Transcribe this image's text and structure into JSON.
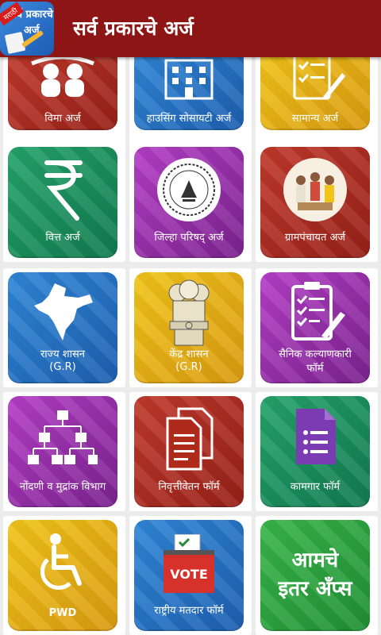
{
  "appbar": {
    "title": "सर्व प्रकारचे अर्ज",
    "icon_text_line1": "सर्व प्रकारचे",
    "icon_text_line2": "अर्ज",
    "icon_ribbon": "मराठी"
  },
  "tiles": [
    {
      "label": "विमा अर्ज",
      "icon": "people-icon"
    },
    {
      "label": "हाउसिंग सोसायटी अर्ज",
      "icon": "building-icon"
    },
    {
      "label": "सामान्य अर्ज",
      "icon": "checklist-icon"
    },
    {
      "label": "वित्त अर्ज",
      "icon": "rupee-icon"
    },
    {
      "label": "जिल्हा परिषद् अर्ज",
      "icon": "seal-icon"
    },
    {
      "label": "ग्रामपंचायत अर्ज",
      "icon": "village-meeting-icon"
    },
    {
      "label_line1": "राज्य शासन",
      "label_line2": "(G.R)",
      "icon": "india-map-icon"
    },
    {
      "label_line1": "केंद्र शासन",
      "label_line2": "(G.R)",
      "icon": "emblem-icon"
    },
    {
      "label_line1": "सैनिक कल्याणकारी",
      "label_line2": "फॉर्म",
      "icon": "clipboard-icon"
    },
    {
      "label": "नोंदणी व मुद्रांक विभाग",
      "icon": "org-chart-icon"
    },
    {
      "label": "निवृत्तीवेतन फॉर्म",
      "icon": "documents-icon"
    },
    {
      "label": "कामगार फॉर्म",
      "icon": "form-icon"
    },
    {
      "label": "PWD",
      "icon": "wheelchair-icon"
    },
    {
      "label": "राष्ट्रीय मतदार फॉर्म",
      "icon": "vote-icon",
      "icon_text": "VOTE"
    },
    {
      "line1": "आमचे",
      "line2": "इतर अँप्स"
    }
  ]
}
